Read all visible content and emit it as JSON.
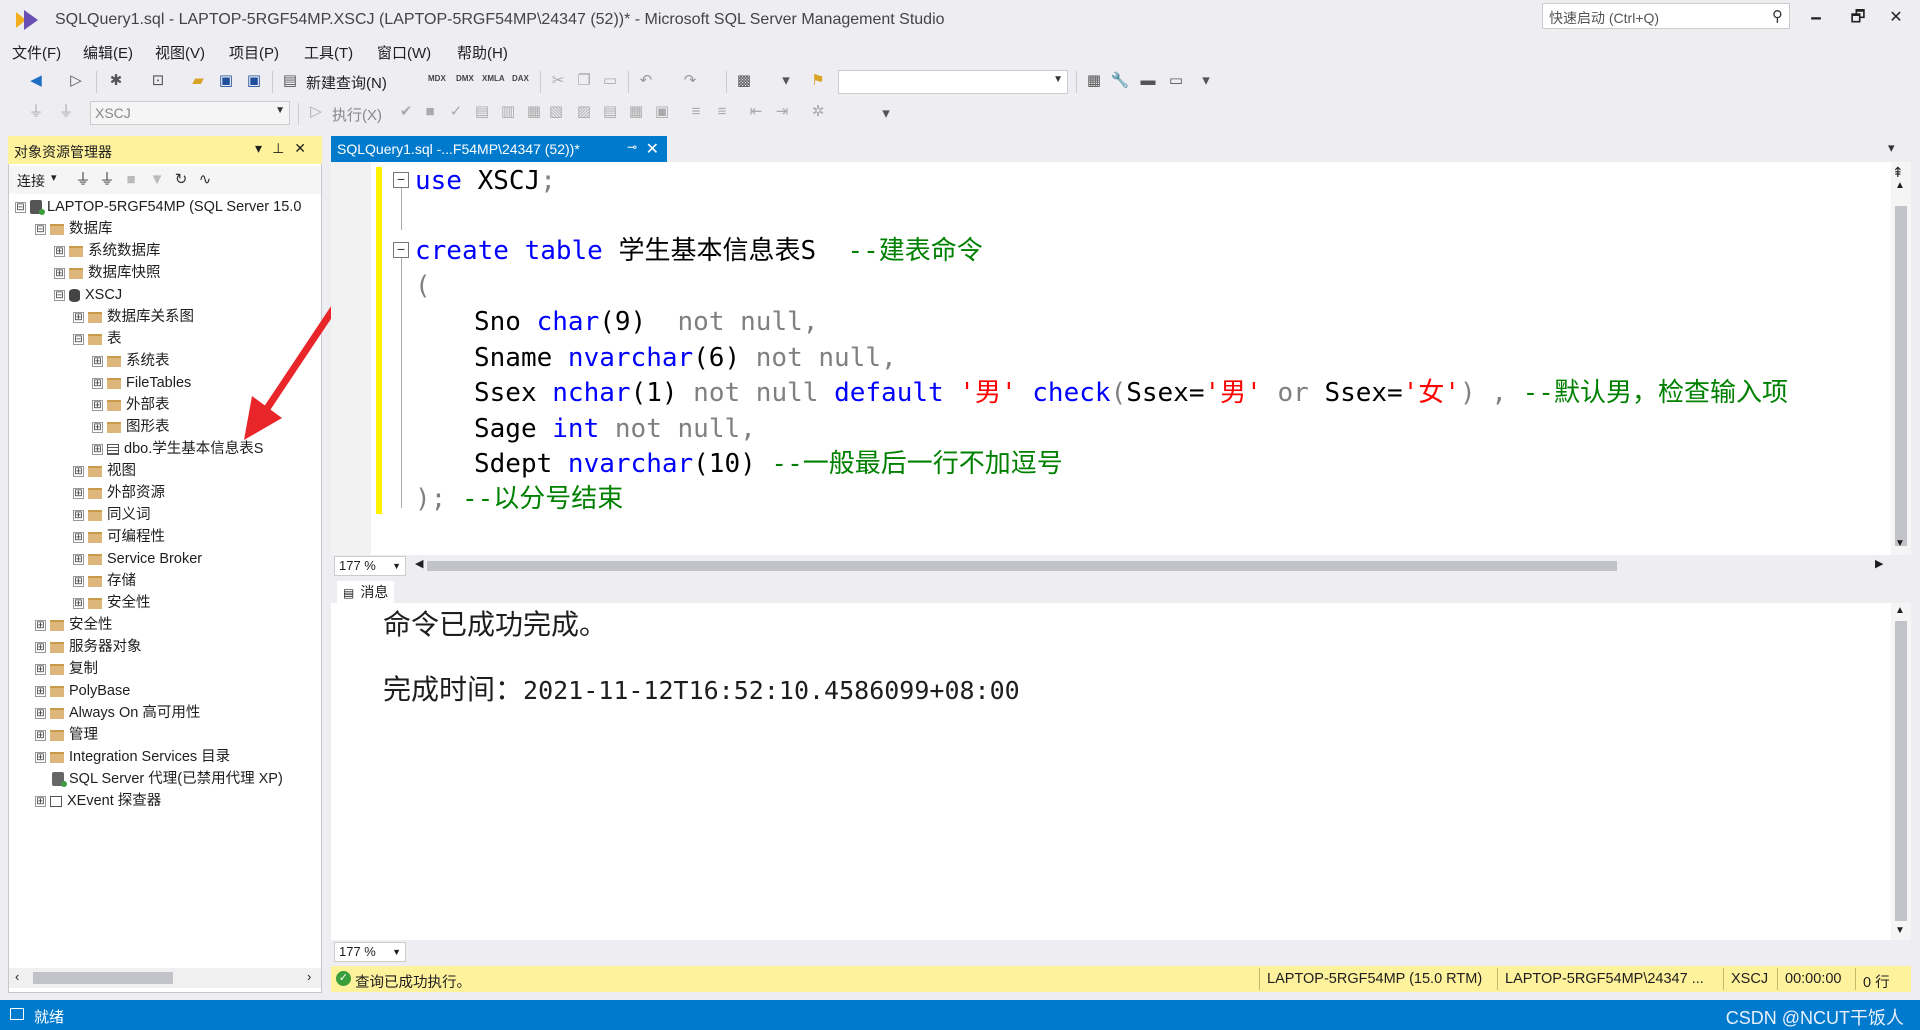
{
  "window": {
    "title": "SQLQuery1.sql - LAPTOP-5RGF54MP.XSCJ (LAPTOP-5RGF54MP\\24347 (52))* - Microsoft SQL Server Management Studio",
    "quick_launch_placeholder": "快速启动 (Ctrl+Q)",
    "minimize": "🗕",
    "maximize": "🗗",
    "close": "✕"
  },
  "menu": [
    "文件(F)",
    "编辑(E)",
    "视图(V)",
    "项目(P)",
    "工具(T)",
    "窗口(W)",
    "帮助(H)"
  ],
  "toolbar": {
    "new_query_label": "新建查询(N)",
    "mdx": "MDX",
    "dmx": "DMX",
    "xmla": "XMLA",
    "dax": "DAX",
    "database_combo": "XSCJ",
    "execute_label": "执行(X)"
  },
  "object_explorer": {
    "title": "对象资源管理器",
    "connect_label": "连接",
    "tree": [
      {
        "label": "LAPTOP-5RGF54MP (SQL Server 15.0",
        "expander": "⊟",
        "icon": "server"
      },
      {
        "label": "数据库",
        "expander": "⊟",
        "icon": "folder"
      },
      {
        "label": "系统数据库",
        "expander": "⊞",
        "icon": "folder"
      },
      {
        "label": "数据库快照",
        "expander": "⊞",
        "icon": "folder"
      },
      {
        "label": "XSCJ",
        "expander": "⊟",
        "icon": "database"
      },
      {
        "label": "数据库关系图",
        "expander": "⊞",
        "icon": "folder"
      },
      {
        "label": "表",
        "expander": "⊟",
        "icon": "folder"
      },
      {
        "label": "系统表",
        "expander": "⊞",
        "icon": "folder"
      },
      {
        "label": "FileTables",
        "expander": "⊞",
        "icon": "folder"
      },
      {
        "label": "外部表",
        "expander": "⊞",
        "icon": "folder"
      },
      {
        "label": "图形表",
        "expander": "⊞",
        "icon": "folder"
      },
      {
        "label": "dbo.学生基本信息表S",
        "expander": "⊞",
        "icon": "table"
      },
      {
        "label": "视图",
        "expander": "⊞",
        "icon": "folder"
      },
      {
        "label": "外部资源",
        "expander": "⊞",
        "icon": "folder"
      },
      {
        "label": "同义词",
        "expander": "⊞",
        "icon": "folder"
      },
      {
        "label": "可编程性",
        "expander": "⊞",
        "icon": "folder"
      },
      {
        "label": "Service Broker",
        "expander": "⊞",
        "icon": "folder"
      },
      {
        "label": "存储",
        "expander": "⊞",
        "icon": "folder"
      },
      {
        "label": "安全性",
        "expander": "⊞",
        "icon": "folder"
      },
      {
        "label": "安全性",
        "expander": "⊞",
        "icon": "folder"
      },
      {
        "label": "服务器对象",
        "expander": "⊞",
        "icon": "folder"
      },
      {
        "label": "复制",
        "expander": "⊞",
        "icon": "folder"
      },
      {
        "label": "PolyBase",
        "expander": "⊞",
        "icon": "folder"
      },
      {
        "label": "Always On 高可用性",
        "expander": "⊞",
        "icon": "folder"
      },
      {
        "label": "管理",
        "expander": "⊞",
        "icon": "folder"
      },
      {
        "label": "Integration Services 目录",
        "expander": "⊞",
        "icon": "folder"
      },
      {
        "label": "SQL Server 代理(已禁用代理 XP)",
        "expander": "",
        "icon": "agent"
      },
      {
        "label": "XEvent 探查器",
        "expander": "⊞",
        "icon": "xevent"
      }
    ]
  },
  "editor": {
    "tab_label": "SQLQuery1.sql -...F54MP\\24347 (52))*",
    "zoom": "177 %",
    "fold_open": "−",
    "code": {
      "l1": {
        "kw": "use",
        "rest": " XSCJ",
        "punct": ";"
      },
      "l2": {
        "kw": "create table",
        "rest": " 学生基本信息表S  ",
        "comment": "--建表命令"
      },
      "l3": {
        "paren": "("
      },
      "l4": {
        "col": "Sno ",
        "type": "char",
        "args": "(9)",
        "tail": "  not null,"
      },
      "l5": {
        "col": "Sname ",
        "type": "nvarchar",
        "args": "(6)",
        "tail": " not null,"
      },
      "l6": {
        "col": "Ssex ",
        "type": "nchar",
        "args": "(1)",
        "tail": " not null ",
        "kw_default": "default",
        "str1": " '男' ",
        "kw_check": "check",
        "p1": "(",
        "ssex1": "Ssex=",
        "str2": "'男'",
        "or": " or ",
        "ssex2": "Ssex=",
        "str3": "'女'",
        "p2": ") , ",
        "comment": "--默认男，检查输入项"
      },
      "l7": {
        "col": "Sage ",
        "type": "int",
        "tail": " not null,"
      },
      "l8": {
        "col": "Sdept ",
        "type": "nvarchar",
        "args": "(10)",
        "comment": " --一般最后一行不加逗号"
      },
      "l9": {
        "close": ");",
        "comment": " --以分号结束"
      }
    }
  },
  "results": {
    "tab_label": "消息",
    "line1": "命令已成功完成。",
    "line2_label": "完成时间：",
    "line2_value": "2021-11-12T16:52:10.4586099+08:00",
    "zoom": "177 %"
  },
  "query_status": {
    "message": "查询已成功执行。",
    "server": "LAPTOP-5RGF54MP (15.0 RTM)",
    "user": "LAPTOP-5RGF54MP\\24347 ...",
    "database": "XSCJ",
    "elapsed": "00:00:00",
    "rows": "0 行"
  },
  "app_status": {
    "text": "就绪",
    "watermark": "CSDN @NCUT干饭人"
  },
  "colors": {
    "accent": "#007acc",
    "highlight_yellow": "#fff29d",
    "arrow": "#e8262a",
    "keyword": "#0000ff",
    "comment": "#008000",
    "string": "#ff0000"
  }
}
